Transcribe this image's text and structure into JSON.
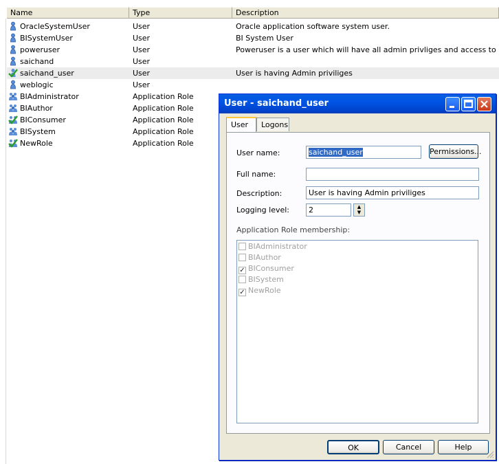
{
  "columns": {
    "name": "Name",
    "type": "Type",
    "description": "Description"
  },
  "rows": [
    {
      "name": "OracleSystemUser",
      "type": "User",
      "description": "Oracle application software system user.",
      "icon": "user-icon"
    },
    {
      "name": "BISystemUser",
      "type": "User",
      "description": "BI System User",
      "icon": "user-icon"
    },
    {
      "name": "poweruser",
      "type": "User",
      "description": "Poweruser is a user which will have all admin privliges and access to analysis too",
      "icon": "user-icon"
    },
    {
      "name": "saichand",
      "type": "User",
      "description": "",
      "icon": "user-icon"
    },
    {
      "name": "saichand_user",
      "type": "User",
      "description": "User is having Admin priviliges",
      "icon": "checked-user-icon",
      "selected": true
    },
    {
      "name": "weblogic",
      "type": "User",
      "description": "",
      "icon": "user-icon"
    },
    {
      "name": "BIAdministrator",
      "type": "Application Role",
      "description": "",
      "icon": "role-icon"
    },
    {
      "name": "BIAuthor",
      "type": "Application Role",
      "description": "",
      "icon": "role-icon"
    },
    {
      "name": "BIConsumer",
      "type": "Application Role",
      "description": "",
      "icon": "checked-role-icon"
    },
    {
      "name": "BISystem",
      "type": "Application Role",
      "description": "",
      "icon": "role-icon"
    },
    {
      "name": "NewRole",
      "type": "Application Role",
      "description": "",
      "icon": "checked-role-icon"
    }
  ],
  "dialog": {
    "title": "User - saichand_user",
    "tabs": [
      "User",
      "Logons"
    ],
    "user_name_label": "User name:",
    "user_name_value": "saichand_user",
    "permissions_button": "Permissions...",
    "full_name_label": "Full name:",
    "full_name_value": "",
    "description_label": "Description:",
    "description_value": "User is having Admin priviliges",
    "logging_level_label": "Logging level:",
    "logging_level_value": "2",
    "membership_label": "Application Role membership:",
    "roles": [
      {
        "name": "BIAdministrator",
        "checked": false
      },
      {
        "name": "BIAuthor",
        "checked": false
      },
      {
        "name": "BIConsumer",
        "checked": true
      },
      {
        "name": "BISystem",
        "checked": false
      },
      {
        "name": "NewRole",
        "checked": true
      }
    ],
    "ok_button": "OK",
    "cancel_button": "Cancel",
    "help_button": "Help"
  }
}
